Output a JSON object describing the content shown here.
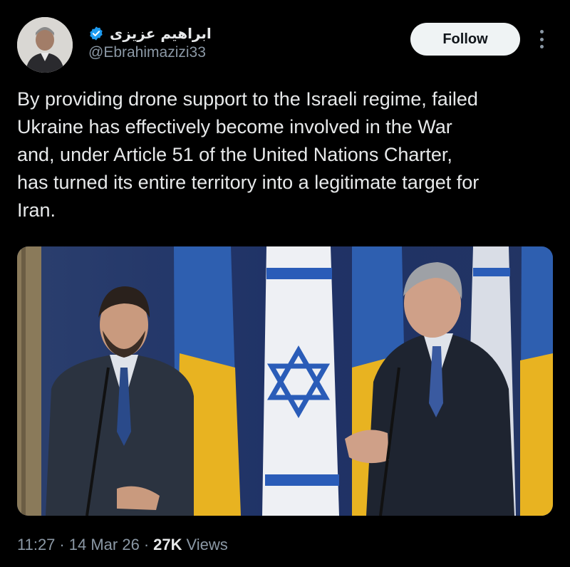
{
  "author": {
    "display_name": "ابراهیم عزیزی",
    "handle": "@Ebrahimazizi33",
    "verified": true,
    "verified_badge_color": "#1d9bf0"
  },
  "actions": {
    "follow_label": "Follow",
    "more_icon": "more-vertical-icon"
  },
  "tweet": {
    "text": "By providing drone support to the Israeli regime, failed\nUkraine has effectively become involved in the War\nand, under Article 51 of the United Nations Charter,\nhas turned its entire territory into a legitimate target for\nIran."
  },
  "meta": {
    "time": "11:27",
    "separator": "·",
    "date": "14 Mar 26",
    "views_count": "27K",
    "views_label": "Views"
  },
  "colors": {
    "background": "#000000",
    "text_primary": "#e7e9ea",
    "text_secondary": "#8b98a5",
    "follow_bg": "#eff3f4"
  }
}
